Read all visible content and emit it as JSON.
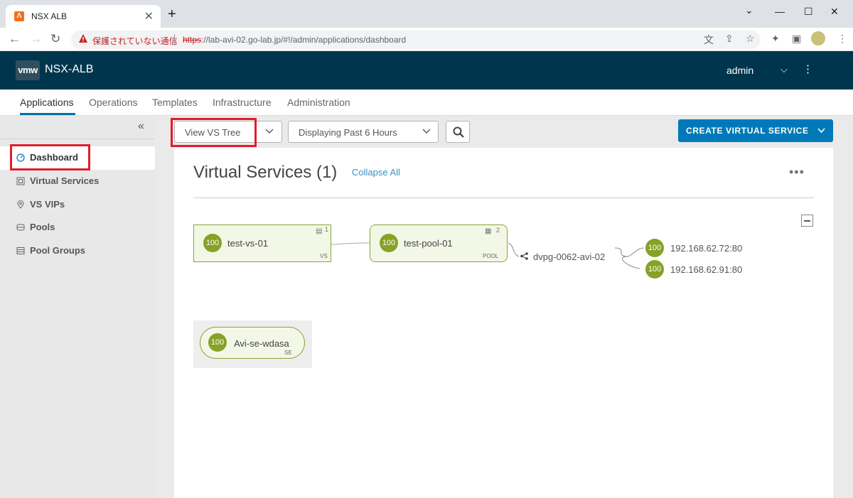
{
  "browser": {
    "tab_title": "NSX ALB",
    "tab_close": "✕",
    "new_tab": "+",
    "window_controls": {
      "minimize": "—",
      "maximize": "☐",
      "close": "✕",
      "chevron": "⌄"
    },
    "security_label": "保護されていない通信",
    "url_scheme": "https",
    "url_rest": "://lab-avi-02.go-lab.jp/#!/admin/applications/dashboard"
  },
  "header": {
    "logo_text": "vmw",
    "app_title": "NSX-ALB",
    "user": "admin"
  },
  "main_nav": {
    "tabs": [
      {
        "label": "Applications",
        "active": true
      },
      {
        "label": "Operations"
      },
      {
        "label": "Templates"
      },
      {
        "label": "Infrastructure"
      },
      {
        "label": "Administration"
      }
    ]
  },
  "sidebar": {
    "collapse_icon": "«",
    "items": [
      {
        "label": "Dashboard",
        "icon": "dashboard-icon",
        "active": true
      },
      {
        "label": "Virtual Services",
        "icon": "virtual-services-icon"
      },
      {
        "label": "VS VIPs",
        "icon": "map-pin-icon"
      },
      {
        "label": "Pools",
        "icon": "pools-icon"
      },
      {
        "label": "Pool Groups",
        "icon": "pool-groups-icon"
      }
    ]
  },
  "toolbar": {
    "view_select": "View VS Tree",
    "time_select": "Displaying Past 6 Hours",
    "create_button": "CREATE VIRTUAL SERVICE"
  },
  "panel": {
    "title": "Virtual Services (1)",
    "collapse_all": "Collapse All",
    "more": "•••"
  },
  "tree": {
    "vs": {
      "health": "100",
      "name": "test-vs-01",
      "type": "VS",
      "count": "1"
    },
    "pool": {
      "health": "100",
      "name": "test-pool-01",
      "type": "POOL",
      "count": "2"
    },
    "network": {
      "name": "dvpg-0062-avi-02"
    },
    "servers": [
      {
        "health": "100",
        "address": "192.168.62.72:80"
      },
      {
        "health": "100",
        "address": "192.168.62.91:80"
      }
    ],
    "se": {
      "health": "100",
      "name": "Avi-se-wdasa",
      "type": "SE"
    }
  },
  "colors": {
    "header_bg": "#00364d",
    "accent": "#0079b8",
    "health_green": "#86a227",
    "highlight_red": "#e11d2a"
  }
}
